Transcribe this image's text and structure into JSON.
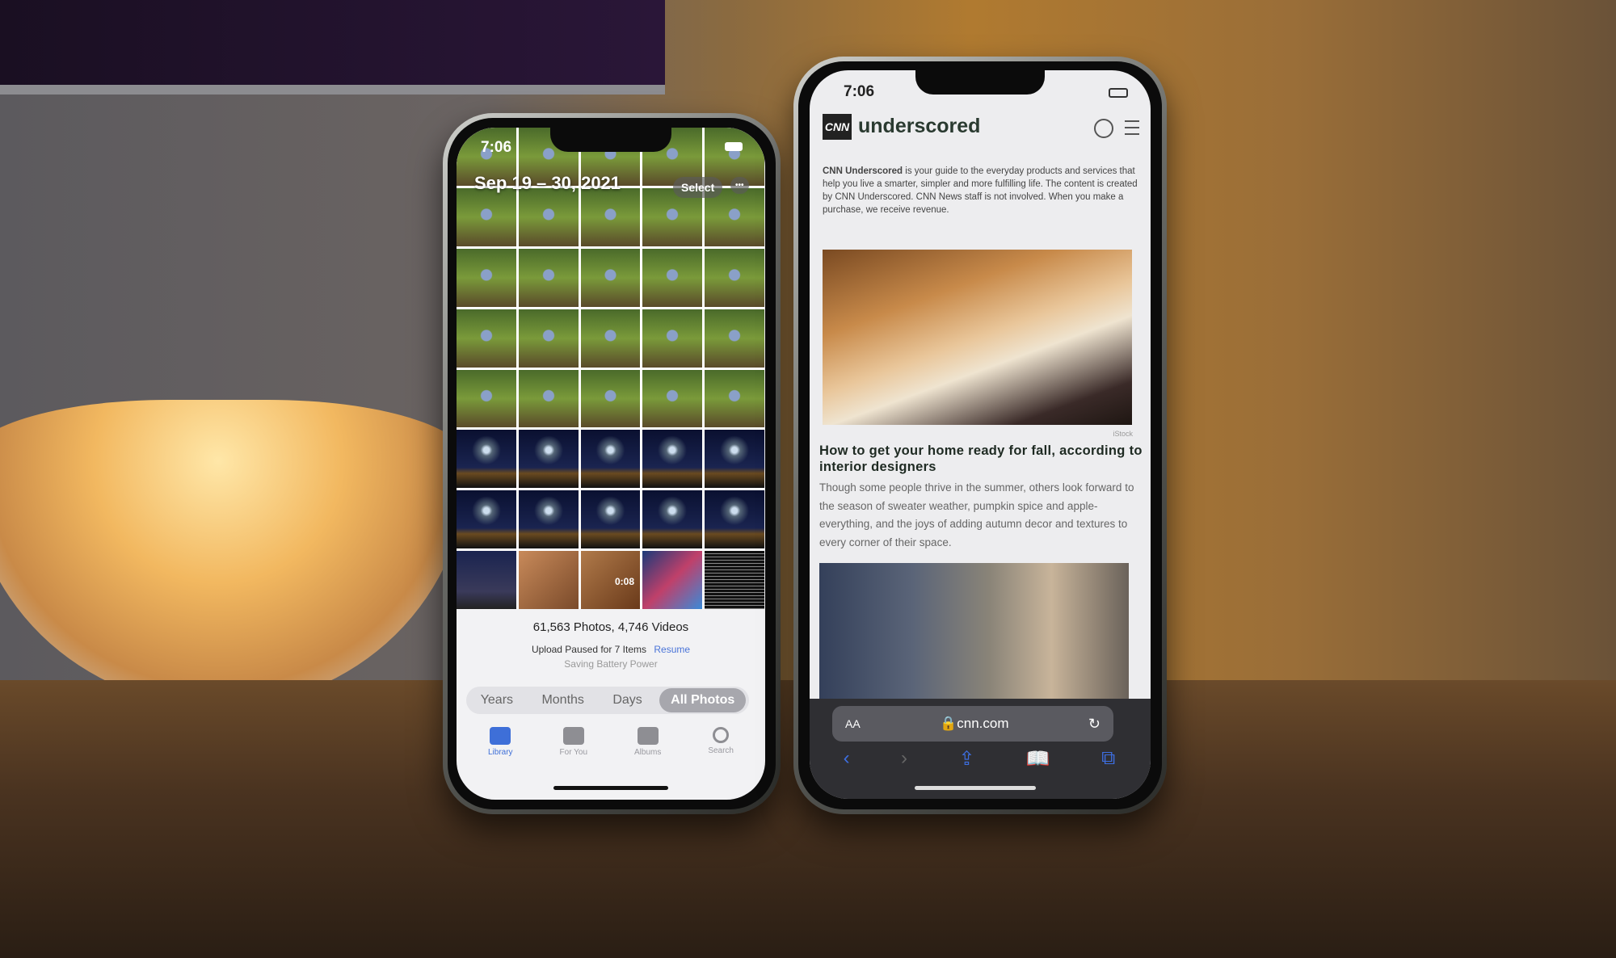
{
  "photos_app": {
    "status_time": "7:06",
    "date_range": "Sep 19 – 30, 2021",
    "select_label": "Select",
    "more_label": "•••",
    "video_duration": "0:08",
    "library_count": "61,563 Photos, 4,746 Videos",
    "upload_status": "Upload Paused for 7 Items",
    "resume_label": "Resume",
    "battery_note": "Saving Battery Power",
    "segments": [
      {
        "label": "Years"
      },
      {
        "label": "Months"
      },
      {
        "label": "Days"
      },
      {
        "label": "All Photos",
        "selected": true
      }
    ],
    "tabs": [
      {
        "label": "Library",
        "icon": "photo-library-icon",
        "active": true
      },
      {
        "label": "For You",
        "icon": "for-you-icon"
      },
      {
        "label": "Albums",
        "icon": "albums-icon"
      },
      {
        "label": "Search",
        "icon": "search-icon"
      }
    ],
    "accent_color": "#3e6fd8"
  },
  "safari": {
    "status_time": "7:06",
    "logo_badge": "CNN",
    "site_name": "underscored",
    "disclaimer_bold": "CNN Underscored",
    "disclaimer": " is your guide to the everyday products and services that help you live a smarter, simpler and more fulfilling life. The content is created by CNN Underscored. CNN News staff is not involved. When you make a purchase, we receive revenue.",
    "image_credit": "iStock",
    "headline": "How to get your home ready for fall, according to interior designers",
    "summary": "Though some people thrive in the summer, others look forward to the season of sweater weather, pumpkin spice and apple-everything, and the joys of adding autumn decor and textures to every corner of their space.",
    "text_size_label": "AA",
    "url": "cnn.com",
    "accent_color": "#3d6ee0"
  }
}
